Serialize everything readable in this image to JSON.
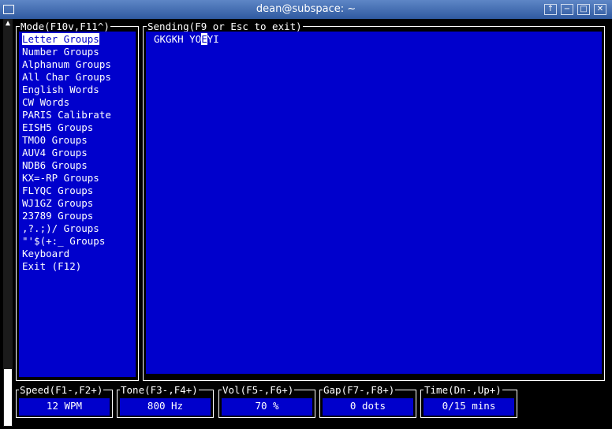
{
  "window": {
    "title": "dean@subspace: ~",
    "buttons": [
      "↑",
      "−",
      "□",
      "✕"
    ]
  },
  "mode_panel": {
    "title": "Mode(F10v,F11^)",
    "items": [
      "Letter Groups",
      "Number Groups",
      "Alphanum Groups",
      "All Char Groups",
      "English Words",
      "CW Words",
      "PARIS Calibrate",
      "EISH5 Groups",
      "TMO0 Groups",
      "AUV4 Groups",
      "NDB6 Groups",
      "KX=-RP Groups",
      "FLYQC Groups",
      "WJ1GZ Groups",
      "23789 Groups",
      ",?.;)/ Groups",
      "\"'$(+:_ Groups",
      "Keyboard",
      "Exit (F12)"
    ],
    "selected_index": 0
  },
  "sending_panel": {
    "title": "Sending(F9 or Esc to exit)",
    "text_before": "GKGKH YO",
    "cursor_char": "E",
    "text_after": "YI"
  },
  "status": {
    "speed": {
      "label": "Speed(F1-,F2+)",
      "value": "12 WPM"
    },
    "tone": {
      "label": "Tone(F3-,F4+)",
      "value": "800 Hz"
    },
    "vol": {
      "label": "Vol(F5-,F6+)",
      "value": "70 %"
    },
    "gap": {
      "label": "Gap(F7-,F8+)",
      "value": "0 dots"
    },
    "time": {
      "label": "Time(Dn-,Up+)",
      "value": "0/15 mins"
    }
  },
  "colors": {
    "panel_bg": "#0000cc",
    "titlebar": "#3d6ab3",
    "text": "#ffffff"
  }
}
